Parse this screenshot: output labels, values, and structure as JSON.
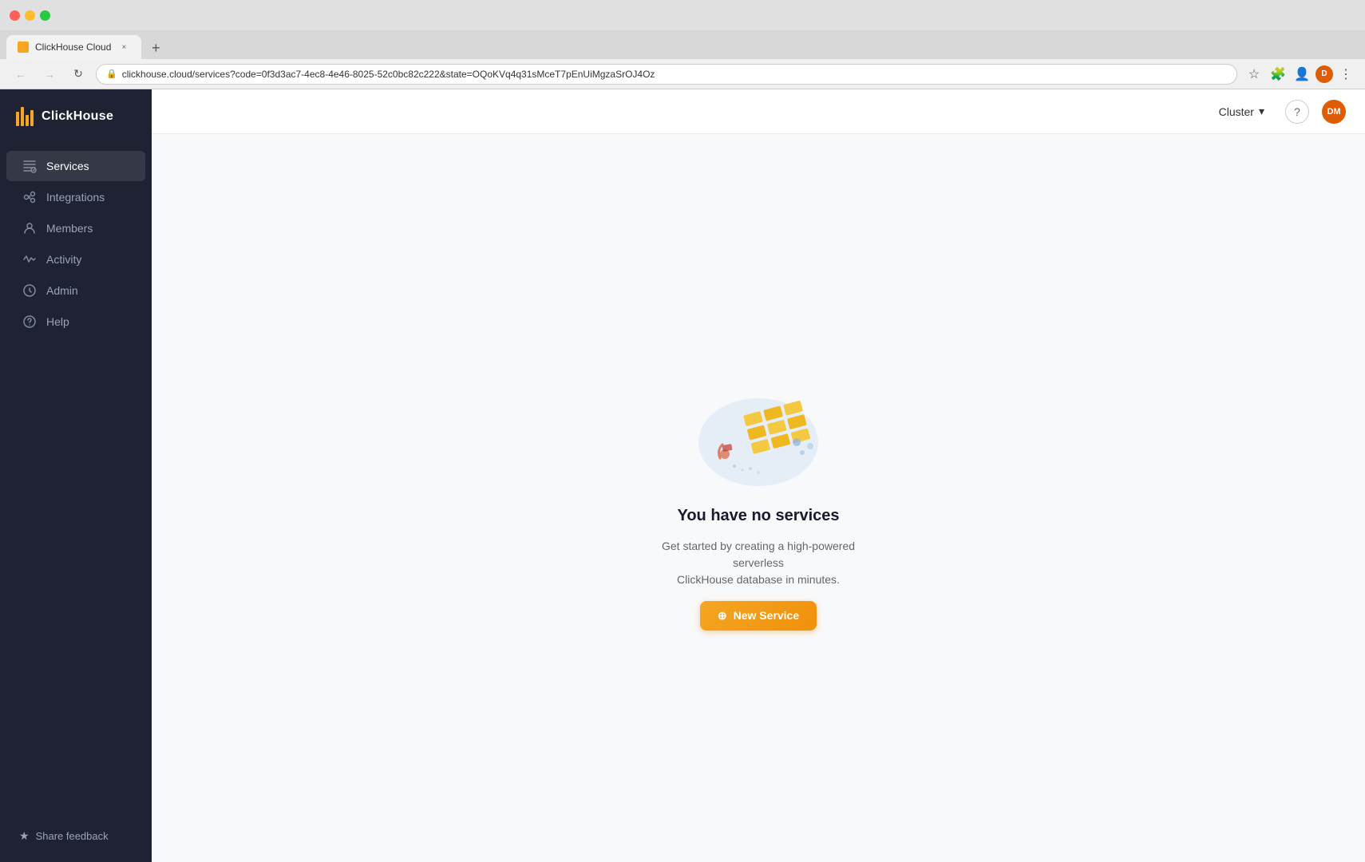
{
  "browser": {
    "tab": {
      "favicon_alt": "ClickHouse favicon",
      "title": "ClickHouse Cloud",
      "close_label": "×"
    },
    "new_tab_label": "+",
    "url": "clickhouse.cloud/services?code=0f3d3ac7-4ec8-4e46-8025-52c0bc82c222&state=OQoKVq4q31sMceT7pEnUiMgzaSrOJ4Oz",
    "url_prefix": "",
    "nav": {
      "back": "←",
      "forward": "→",
      "refresh": "↻"
    }
  },
  "header": {
    "cluster_label": "Cluster",
    "help_label": "?",
    "user_initials": "DM"
  },
  "sidebar": {
    "logo_text": "ClickHouse",
    "nav_items": [
      {
        "id": "services",
        "label": "Services",
        "active": true
      },
      {
        "id": "integrations",
        "label": "Integrations",
        "active": false
      },
      {
        "id": "members",
        "label": "Members",
        "active": false
      },
      {
        "id": "activity",
        "label": "Activity",
        "active": false
      },
      {
        "id": "admin",
        "label": "Admin",
        "active": false
      },
      {
        "id": "help",
        "label": "Help",
        "active": false
      }
    ],
    "footer": {
      "feedback_label": "Share feedback"
    }
  },
  "main": {
    "empty_state": {
      "title": "You have no services",
      "description_line1": "Get started by creating a high-powered serverless",
      "description_line2": "ClickHouse database in minutes.",
      "new_service_label": "New Service",
      "new_service_icon": "+"
    }
  }
}
